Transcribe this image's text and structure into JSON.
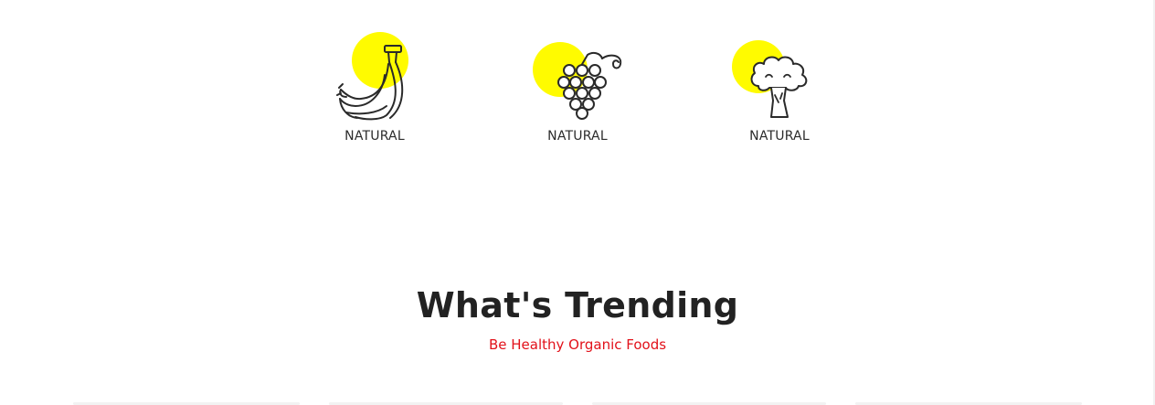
{
  "categories": [
    {
      "label": "NATURAL",
      "icon": "banana-icon"
    },
    {
      "label": "NATURAL",
      "icon": "grapes-icon"
    },
    {
      "label": "NATURAL",
      "icon": "broccoli-icon"
    }
  ],
  "trending": {
    "title": "What's Trending",
    "subtitle": "Be Healthy Organic Foods"
  },
  "colors": {
    "accent_circle": "#fffb00",
    "subtitle": "#e2111a",
    "heading": "#222222"
  }
}
